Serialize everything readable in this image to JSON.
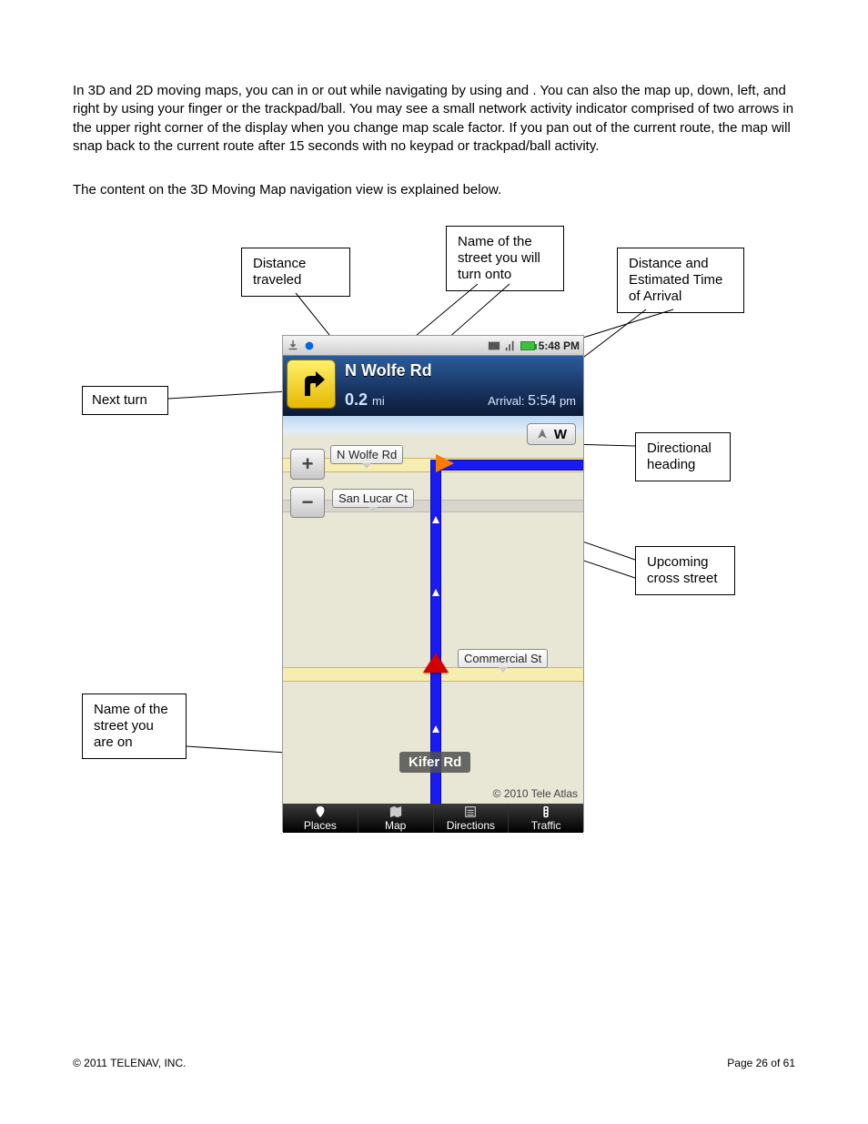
{
  "paragraph1_a": "In 3D and 2D moving maps, you can ",
  "paragraph1_b": " in or out while navigating by using ",
  "paragraph1_c": " and ",
  "paragraph1_d": ". You can also ",
  "paragraph1_e": " the map up, down, left, and right by using your finger or the trackpad/ball. You may see a small network activity indicator comprised of two arrows in the upper right corner of the display when you change map scale factor. If you pan out of the current route, the map will snap back to the current route after 15 seconds with no keypad or trackpad/ball activity.",
  "paragraph2": "The content on the 3D Moving Map navigation view is explained below.",
  "callouts": {
    "distance_traveled": "Distance traveled",
    "street_turn_onto": "Name of the street you will turn onto",
    "eta": "Distance and Estimated Time of Arrival",
    "next_turn": "Next turn",
    "directional": "Directional heading",
    "cross_street": "Upcoming cross street",
    "street_on": "Name of the street you are on"
  },
  "phone": {
    "time": "5:48 PM",
    "next_street": "N Wolfe Rd",
    "distance_value": "0.2",
    "distance_unit": "mi",
    "arrival_label": "Arrival:",
    "arrival_time": "5:54",
    "arrival_ampm": "pm",
    "compass": "W",
    "labels": {
      "wolfe": "N Wolfe Rd",
      "sanlucar": "San Lucar Ct",
      "commercial": "Commercial St",
      "kifer": "Kifer Rd"
    },
    "map_copyright": "© 2010 Tele Atlas",
    "tabs": {
      "places": "Places",
      "map": "Map",
      "directions": "Directions",
      "traffic": "Traffic"
    }
  },
  "footer_left": "© 2011 TELENAV, INC.",
  "footer_right": "Page 26 of 61"
}
